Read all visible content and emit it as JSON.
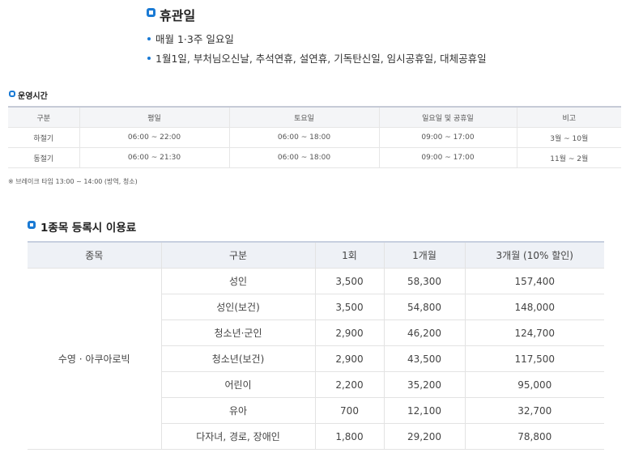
{
  "closed": {
    "title": "휴관일",
    "items": [
      "매월 1·3주 일요일",
      "1월1일, 부처님오신날, 추석연휴, 설연휴, 기독탄신일, 임시공휴일, 대체공휴일"
    ]
  },
  "hours": {
    "title": "운영시간",
    "columns": [
      "구분",
      "평일",
      "토요일",
      "일요일 및 공휴일",
      "비고"
    ],
    "rows": [
      [
        "하절기",
        "06:00 ~ 22:00",
        "06:00 ~ 18:00",
        "09:00 ~ 17:00",
        "3월 ~ 10월"
      ],
      [
        "동절기",
        "06:00 ~ 21:30",
        "06:00 ~ 18:00",
        "09:00 ~ 17:00",
        "11월 ~ 2월"
      ]
    ],
    "note": "※ 브레이크 타임 13:00 ~ 14:00 (방역, 청소)"
  },
  "fees": {
    "title": "1종목 등록시 이용료",
    "columns": [
      "종목",
      "구분",
      "1회",
      "1개월",
      "3개월 (10% 할인)"
    ],
    "sport": "수영 · 아쿠아로빅",
    "rows": [
      [
        "성인",
        "3,500",
        "58,300",
        "157,400"
      ],
      [
        "성인(보건)",
        "3,500",
        "54,800",
        "148,000"
      ],
      [
        "청소년·군인",
        "2,900",
        "46,200",
        "124,700"
      ],
      [
        "청소년(보건)",
        "2,900",
        "43,500",
        "117,500"
      ],
      [
        "어린이",
        "2,200",
        "35,200",
        "95,000"
      ],
      [
        "유아",
        "700",
        "12,100",
        "32,700"
      ],
      [
        "다자녀, 경로, 장애인",
        "1,800",
        "29,200",
        "78,800"
      ]
    ]
  },
  "colors": {
    "accent": "#1a7ad4"
  }
}
